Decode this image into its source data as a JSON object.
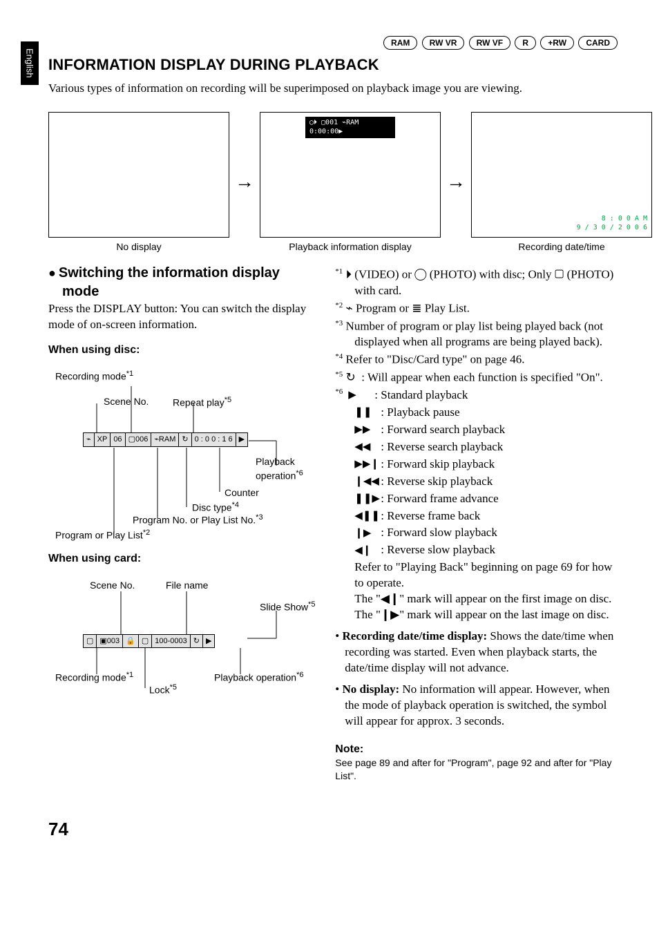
{
  "tab": "English",
  "pills": [
    "RAM",
    "RW VR",
    "RW VF",
    "R",
    "+RW",
    "CARD"
  ],
  "title": "INFORMATION DISPLAY DURING PLAYBACK",
  "intro": "Various types of information on recording will be superimposed on playback image you are viewing.",
  "flow": {
    "captions": [
      "No display",
      "Playback information display",
      "Recording date/time"
    ],
    "pb_bar": "◯⏵ ▢001 ⌁RAM   0:00:00▶",
    "datetime": "8 : 0 0 A M\n9 / 3 0 / 2 0 0 6"
  },
  "heading2": "Switching the information display mode",
  "switch_body": "Press the DISPLAY button: You can switch the display mode of on-screen information.",
  "when_disc": "When using disc:",
  "disc_labels": {
    "recording_mode": "Recording mode",
    "scene_no": "Scene No.",
    "repeat_play": "Repeat play",
    "playback_op": "Playback operation",
    "counter": "Counter",
    "disc_type": "Disc type",
    "program_no": "Program No. or Play List No.",
    "program_or_playlist": "Program or Play List"
  },
  "disc_bar": [
    "⌁",
    "XP",
    "06",
    "▢006",
    "⌁RAM",
    "↻",
    "0 : 0 0 : 1 6",
    "▶"
  ],
  "when_card": "When using card:",
  "card_labels": {
    "scene_no": "Scene No.",
    "file_name": "File name",
    "slide_show": "Slide Show",
    "recording_mode": "Recording mode",
    "playback_op": "Playback operation",
    "lock": "Lock"
  },
  "card_bar": [
    "▢",
    "▣003",
    "🔒",
    "▢",
    "100-0003",
    "↻",
    "▶"
  ],
  "foot": [
    {
      "sup": "*1",
      "text": "⏵ (VIDEO) or ◯ (PHOTO) with disc; Only ▢ (PHOTO) with card."
    },
    {
      "sup": "*2",
      "text": "⌁ Program or ≣ Play List."
    },
    {
      "sup": "*3",
      "text": "Number of program or play list being played back (not displayed when all programs are being played back)."
    },
    {
      "sup": "*4",
      "text": "Refer to \"Disc/Card type\" on page 46."
    },
    {
      "sup": "*5",
      "sym": "↻",
      "text": "Will appear when each function is specified \"On\"."
    }
  ],
  "ops_sup": "*6",
  "ops": [
    {
      "sym": "▶",
      "text": "Standard playback"
    },
    {
      "sym": "❚❚",
      "text": "Playback pause"
    },
    {
      "sym": "▶▶",
      "text": "Forward search playback"
    },
    {
      "sym": "◀◀",
      "text": "Reverse search playback"
    },
    {
      "sym": "▶▶❙",
      "text": "Forward skip playback"
    },
    {
      "sym": "❙◀◀",
      "text": "Reverse skip playback"
    },
    {
      "sym": "❚❚▶",
      "text": "Forward frame advance"
    },
    {
      "sym": "◀❚❚",
      "text": "Reverse frame back"
    },
    {
      "sym": "❙▶",
      "text": "Forward slow playback"
    },
    {
      "sym": "◀❙",
      "text": "Reverse slow playback"
    }
  ],
  "ops_tail": [
    "Refer to \"Playing Back\" beginning on page 69 for how to operate.",
    "The \"◀❙\" mark will appear on the first image on disc.",
    "The \"❙▶\" mark will appear on the last image on disc."
  ],
  "bullets": [
    {
      "bold": "Recording date/time display:",
      "text": " Shows the date/time when recording was started. Even when playback starts, the date/time display will not advance."
    },
    {
      "bold": "No display:",
      "text": " No information will appear. However, when the mode of playback operation is switched, the symbol will appear for approx. 3 seconds."
    }
  ],
  "note_hd": "Note:",
  "note_body": "See page 89 and after for \"Program\", page 92 and after for \"Play List\".",
  "page_no": "74",
  "sups": {
    "s1": "*1",
    "s2": "*2",
    "s3": "*3",
    "s4": "*4",
    "s5": "*5",
    "s6": "*6"
  }
}
